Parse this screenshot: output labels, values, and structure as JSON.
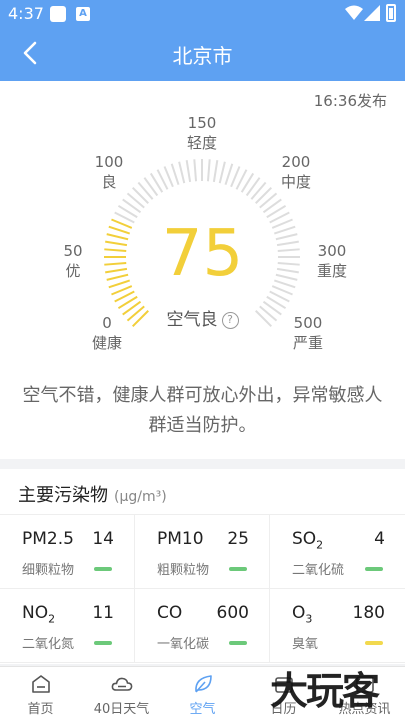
{
  "status": {
    "time": "4:37"
  },
  "header": {
    "title": "北京市"
  },
  "gauge": {
    "publish_time": "16:36发布",
    "aqi": "75",
    "level": "空气良",
    "help": "?",
    "aqi_value_num": 75,
    "scale_max": 500,
    "labels": [
      {
        "value": "0",
        "name": "健康"
      },
      {
        "value": "50",
        "name": "优"
      },
      {
        "value": "100",
        "name": "良"
      },
      {
        "value": "150",
        "name": "轻度"
      },
      {
        "value": "200",
        "name": "中度"
      },
      {
        "value": "300",
        "name": "重度"
      },
      {
        "value": "500",
        "name": "严重"
      }
    ],
    "advice": "空气不错，健康人群可放心外出，异常敏感人群适当防护。",
    "active_color": "#f2cf3a",
    "inactive_color": "#dddddd"
  },
  "pollutants": {
    "title": "主要污染物",
    "unit": "(μg/m³)",
    "items": [
      {
        "name": "PM2.5",
        "sub": "",
        "value": "14",
        "cn": "细颗粒物",
        "color": "#6cc97a"
      },
      {
        "name": "PM10",
        "sub": "",
        "value": "25",
        "cn": "粗颗粒物",
        "color": "#6cc97a"
      },
      {
        "name": "SO",
        "sub": "2",
        "value": "4",
        "cn": "二氧化硫",
        "color": "#6cc97a"
      },
      {
        "name": "NO",
        "sub": "2",
        "value": "11",
        "cn": "二氧化氮",
        "color": "#6cc97a"
      },
      {
        "name": "CO",
        "sub": "",
        "value": "600",
        "cn": "一氧化碳",
        "color": "#6cc97a"
      },
      {
        "name": "O",
        "sub": "3",
        "value": "180",
        "cn": "臭氧",
        "color": "#f2d94e"
      }
    ]
  },
  "nav": {
    "items": [
      {
        "label": "首页",
        "icon": "home-icon"
      },
      {
        "label": "40日天气",
        "icon": "cloud-icon"
      },
      {
        "label": "空气",
        "icon": "leaf-icon"
      },
      {
        "label": "日历",
        "icon": "calendar-icon"
      },
      {
        "label": "热点资讯",
        "icon": "news-icon"
      }
    ]
  },
  "watermark": "大玩客"
}
